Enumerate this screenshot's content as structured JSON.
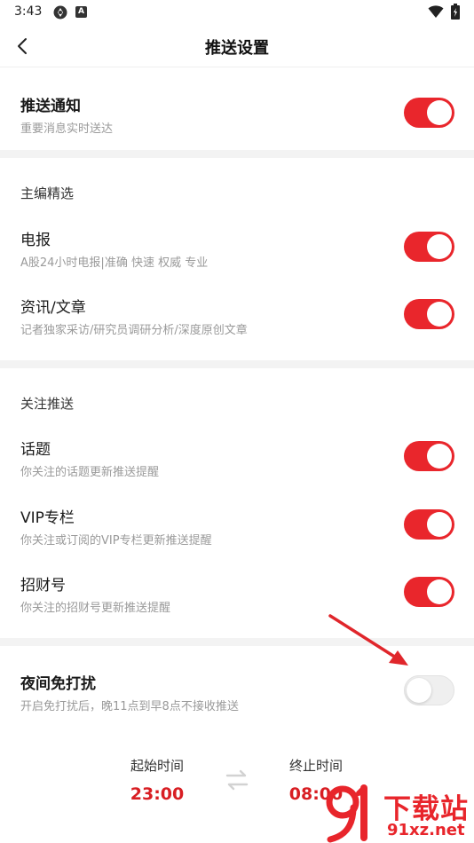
{
  "status_bar": {
    "time": "3:43",
    "badge_letter": "A"
  },
  "header": {
    "title": "推送设置"
  },
  "push_notification": {
    "title": "推送通知",
    "subtitle": "重要消息实时送达",
    "enabled": true
  },
  "editor_picks": {
    "header": "主编精选",
    "items": [
      {
        "title": "电报",
        "subtitle": "A股24小时电报|准确 快速 权威 专业",
        "enabled": true
      },
      {
        "title": "资讯/文章",
        "subtitle": "记者独家采访/研究员调研分析/深度原创文章",
        "enabled": true
      }
    ]
  },
  "follow_push": {
    "header": "关注推送",
    "items": [
      {
        "title": "话题",
        "subtitle": "你关注的话题更新推送提醒",
        "enabled": true
      },
      {
        "title": "VIP专栏",
        "subtitle": "你关注或订阅的VIP专栏更新推送提醒",
        "enabled": true
      },
      {
        "title": "招财号",
        "subtitle": "你关注的招财号更新推送提醒",
        "enabled": true
      }
    ]
  },
  "night_mode": {
    "title": "夜间免打扰",
    "subtitle": "开启免打扰后，晚11点到早8点不接收推送",
    "enabled": false,
    "start_label": "起始时间",
    "start_time": "23:00",
    "end_label": "终止时间",
    "end_time": "08:00"
  },
  "watermark": {
    "text": "下载站",
    "url": "91xz.net"
  },
  "colors": {
    "accent": "#e9262c",
    "time_value": "#d81e23",
    "divider": "#f3f3f3",
    "subtitle": "#9a9a9a"
  }
}
